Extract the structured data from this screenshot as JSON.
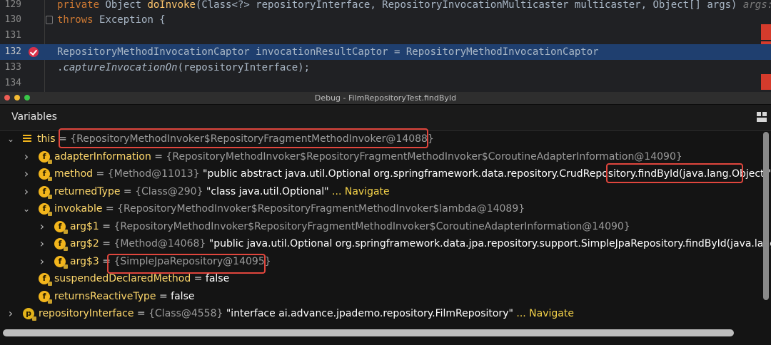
{
  "editor": {
    "lines": [
      {
        "num": "129",
        "segments": [
          {
            "t": "private ",
            "c": "kw"
          },
          {
            "t": "Object ",
            "c": ""
          },
          {
            "t": "doInvoke",
            "c": "fn"
          },
          {
            "t": "(Class<?> repositoryInterface, RepositoryInvocationMulticaster multicaster, Object[] args)",
            "c": ""
          },
          {
            "t": "   args: ",
            "c": "dim"
          }
        ]
      },
      {
        "num": "130",
        "segments": [
          {
            "t": "        throws ",
            "c": "kw"
          },
          {
            "t": "Exception {",
            "c": ""
          }
        ]
      },
      {
        "num": "131",
        "segments": []
      },
      {
        "num": "132",
        "current": true,
        "segments": [
          {
            "t": "    RepositoryMethodInvocationCaptor invocationResultCaptor = RepositoryMethodInvocationCaptor",
            "c": ""
          }
        ]
      },
      {
        "num": "133",
        "segments": [
          {
            "t": "            .",
            "c": ""
          },
          {
            "t": "captureInvocationOn",
            "c": "it"
          },
          {
            "t": "(repositoryInterface);",
            "c": ""
          }
        ]
      },
      {
        "num": "134",
        "segments": []
      }
    ]
  },
  "debug_window": {
    "title": "Debug - FilmRepositoryTest.findById",
    "panel_label": "Variables",
    "traffic_lights": [
      "#ee5d55",
      "#f4bb33",
      "#39c748"
    ]
  },
  "variables": [
    {
      "depth": 0,
      "arrow": "down",
      "icon": "this",
      "name": "this",
      "type": "{RepositoryMethodInvoker$RepositoryFragmentMethodInvoker@14088}",
      "value": "",
      "nav": ""
    },
    {
      "depth": 1,
      "arrow": "right",
      "icon": "f",
      "lock": true,
      "name": "adapterInformation",
      "type": "{RepositoryMethodInvoker$RepositoryFragmentMethodInvoker$CoroutineAdapterInformation@14090}",
      "value": "",
      "nav": ""
    },
    {
      "depth": 1,
      "arrow": "right",
      "icon": "f",
      "lock": true,
      "name": "method",
      "type": "{Method@11013}",
      "value": "\"public abstract java.util.Optional org.springframework.data.repository.CrudRepository.findById(java.lang.Object)\"",
      "nav": ""
    },
    {
      "depth": 1,
      "arrow": "right",
      "icon": "f",
      "lock": true,
      "name": "returnedType",
      "type": "{Class@290}",
      "value": "\"class java.util.Optional\"",
      "nav": "... Navigate"
    },
    {
      "depth": 1,
      "arrow": "down",
      "icon": "f",
      "lock": true,
      "name": "invokable",
      "type": "{RepositoryMethodInvoker$RepositoryFragmentMethodInvoker$lambda@14089}",
      "value": "",
      "nav": ""
    },
    {
      "depth": 2,
      "arrow": "right",
      "icon": "f",
      "lock": true,
      "name": "arg$1",
      "type": "{RepositoryMethodInvoker$RepositoryFragmentMethodInvoker$CoroutineAdapterInformation@14090}",
      "value": "",
      "nav": ""
    },
    {
      "depth": 2,
      "arrow": "right",
      "icon": "f",
      "lock": true,
      "name": "arg$2",
      "type": "{Method@14068}",
      "value": "\"public java.util.Optional org.springframework.data.jpa.repository.support.SimpleJpaRepository.findById(java.lang.Obj",
      "nav": ""
    },
    {
      "depth": 2,
      "arrow": "right",
      "icon": "f",
      "lock": true,
      "name": "arg$3",
      "type": "{SimpleJpaRepository@14095}",
      "value": "",
      "nav": ""
    },
    {
      "depth": 1,
      "arrow": "",
      "icon": "f",
      "lock": true,
      "name": "suspendedDeclaredMethod",
      "type": "",
      "value": "false",
      "nav": ""
    },
    {
      "depth": 1,
      "arrow": "",
      "icon": "f",
      "lock": true,
      "name": "returnsReactiveType",
      "type": "",
      "value": "false",
      "nav": ""
    },
    {
      "depth": 0,
      "arrow": "right",
      "icon": "p",
      "lock": true,
      "name": "repositoryInterface",
      "type": "{Class@4558}",
      "value": "\"interface ai.advance.jpademo.repository.FilmRepository\"",
      "nav": "... Navigate"
    }
  ],
  "colors": {
    "highlight_box": "#e0463d",
    "field_badge": "#f2b51c",
    "current_line": "#1f3f6f"
  }
}
